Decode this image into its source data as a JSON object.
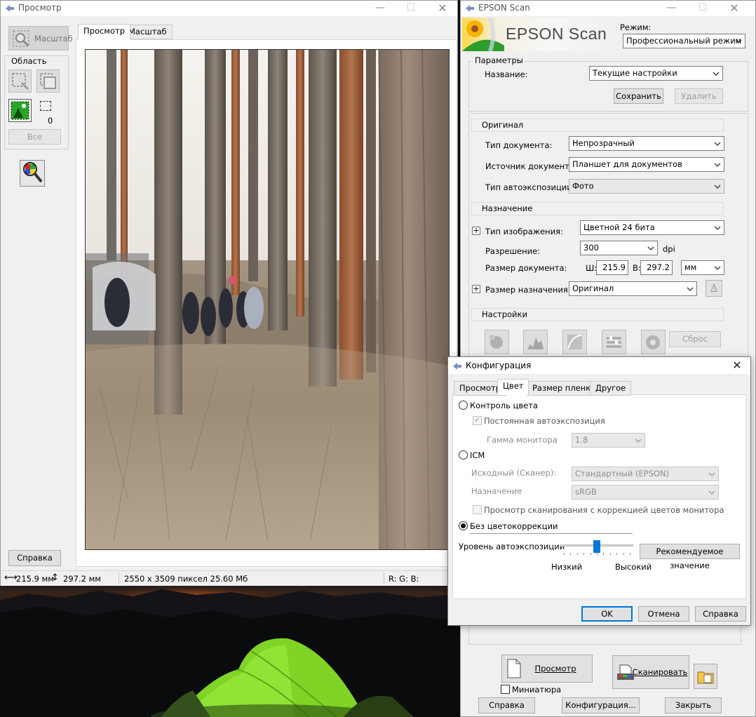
{
  "preview": {
    "title": "Просмотр",
    "zoom_button": "Масштаб",
    "area_label": "Область",
    "marquee_count": "0",
    "all_button": "Все",
    "help_button": "Справка",
    "tabs": [
      "Просмотр",
      "Масштаб"
    ],
    "status": {
      "width": "215.9 мм",
      "height": "297.2 мм",
      "pixels": "2550 x 3509 пиксел 25.60 Мб",
      "rgb": "R: G: B:"
    }
  },
  "epson": {
    "title": "EPSON Scan",
    "logo_text": "EPSON Scan",
    "mode_label": "Режим:",
    "mode_value": "Профессиональный режим",
    "params_label": "Параметры",
    "name_label": "Название:",
    "name_value": "Текущие настройки",
    "save_button": "Сохранить",
    "delete_button": "Удалить",
    "original_header": "Оригинал",
    "doc_type_label": "Тип документа:",
    "doc_type_value": "Непрозрачный",
    "doc_source_label": "Источник документа:",
    "doc_source_value": "Планшет для документов",
    "autoexp_type_label": "Тип автоэкспозиции:",
    "autoexp_type_value": "Фото",
    "dest_header": "Назначение",
    "image_type_label": "Тип изображения:",
    "image_type_value": "Цветной 24 бита",
    "resolution_label": "Разрешение:",
    "resolution_value": "300",
    "resolution_unit": "dpi",
    "doc_size_label": "Размер документа:",
    "w_label": "Ш:",
    "w_value": "215.9",
    "h_label": "В:",
    "h_value": "297.2",
    "size_unit": "мм",
    "target_size_label": "Размер назначения:",
    "target_size_value": "Оригинал",
    "settings_header": "Настройки",
    "reset_button": "Сброс",
    "preview_button": "Просмотр",
    "scan_button": "Сканировать",
    "thumbnail_label": "Миниатюра",
    "help_button": "Справка",
    "config_button": "Конфигурация...",
    "close_button": "Закрыть"
  },
  "config": {
    "title": "Конфигурация",
    "tabs": [
      "Просмотр",
      "Цвет",
      "Размер пленки",
      "Другое"
    ],
    "active_tab": "Цвет",
    "color_control": "Контроль цвета",
    "continuous_autoexp": "Постоянная автоэкспозиция",
    "monitor_gamma_label": "Гамма монитора",
    "monitor_gamma_value": "1.8",
    "icm": "ICM",
    "source_label": "Исходный (Сканер):",
    "source_value": "Стандартный (EPSON)",
    "target_label": "Назначение",
    "target_value": "sRGB",
    "preview_with_monitor": "Просмотр сканирования с коррекцией цветов монитора",
    "no_color_correction": "Без цветокоррекции",
    "autoexp_level_label": "Уровень автоэкспозиции",
    "recommended_button": "Рекомендуемое значение",
    "low_label": "Низкий",
    "high_label": "Высокий",
    "autoexp_level_fraction": 0.5,
    "ok_button": "OK",
    "cancel_button": "Отмена",
    "help_button": "Справка"
  },
  "colors": {
    "accent": "#0078d7",
    "tent": "#8ee02e"
  }
}
